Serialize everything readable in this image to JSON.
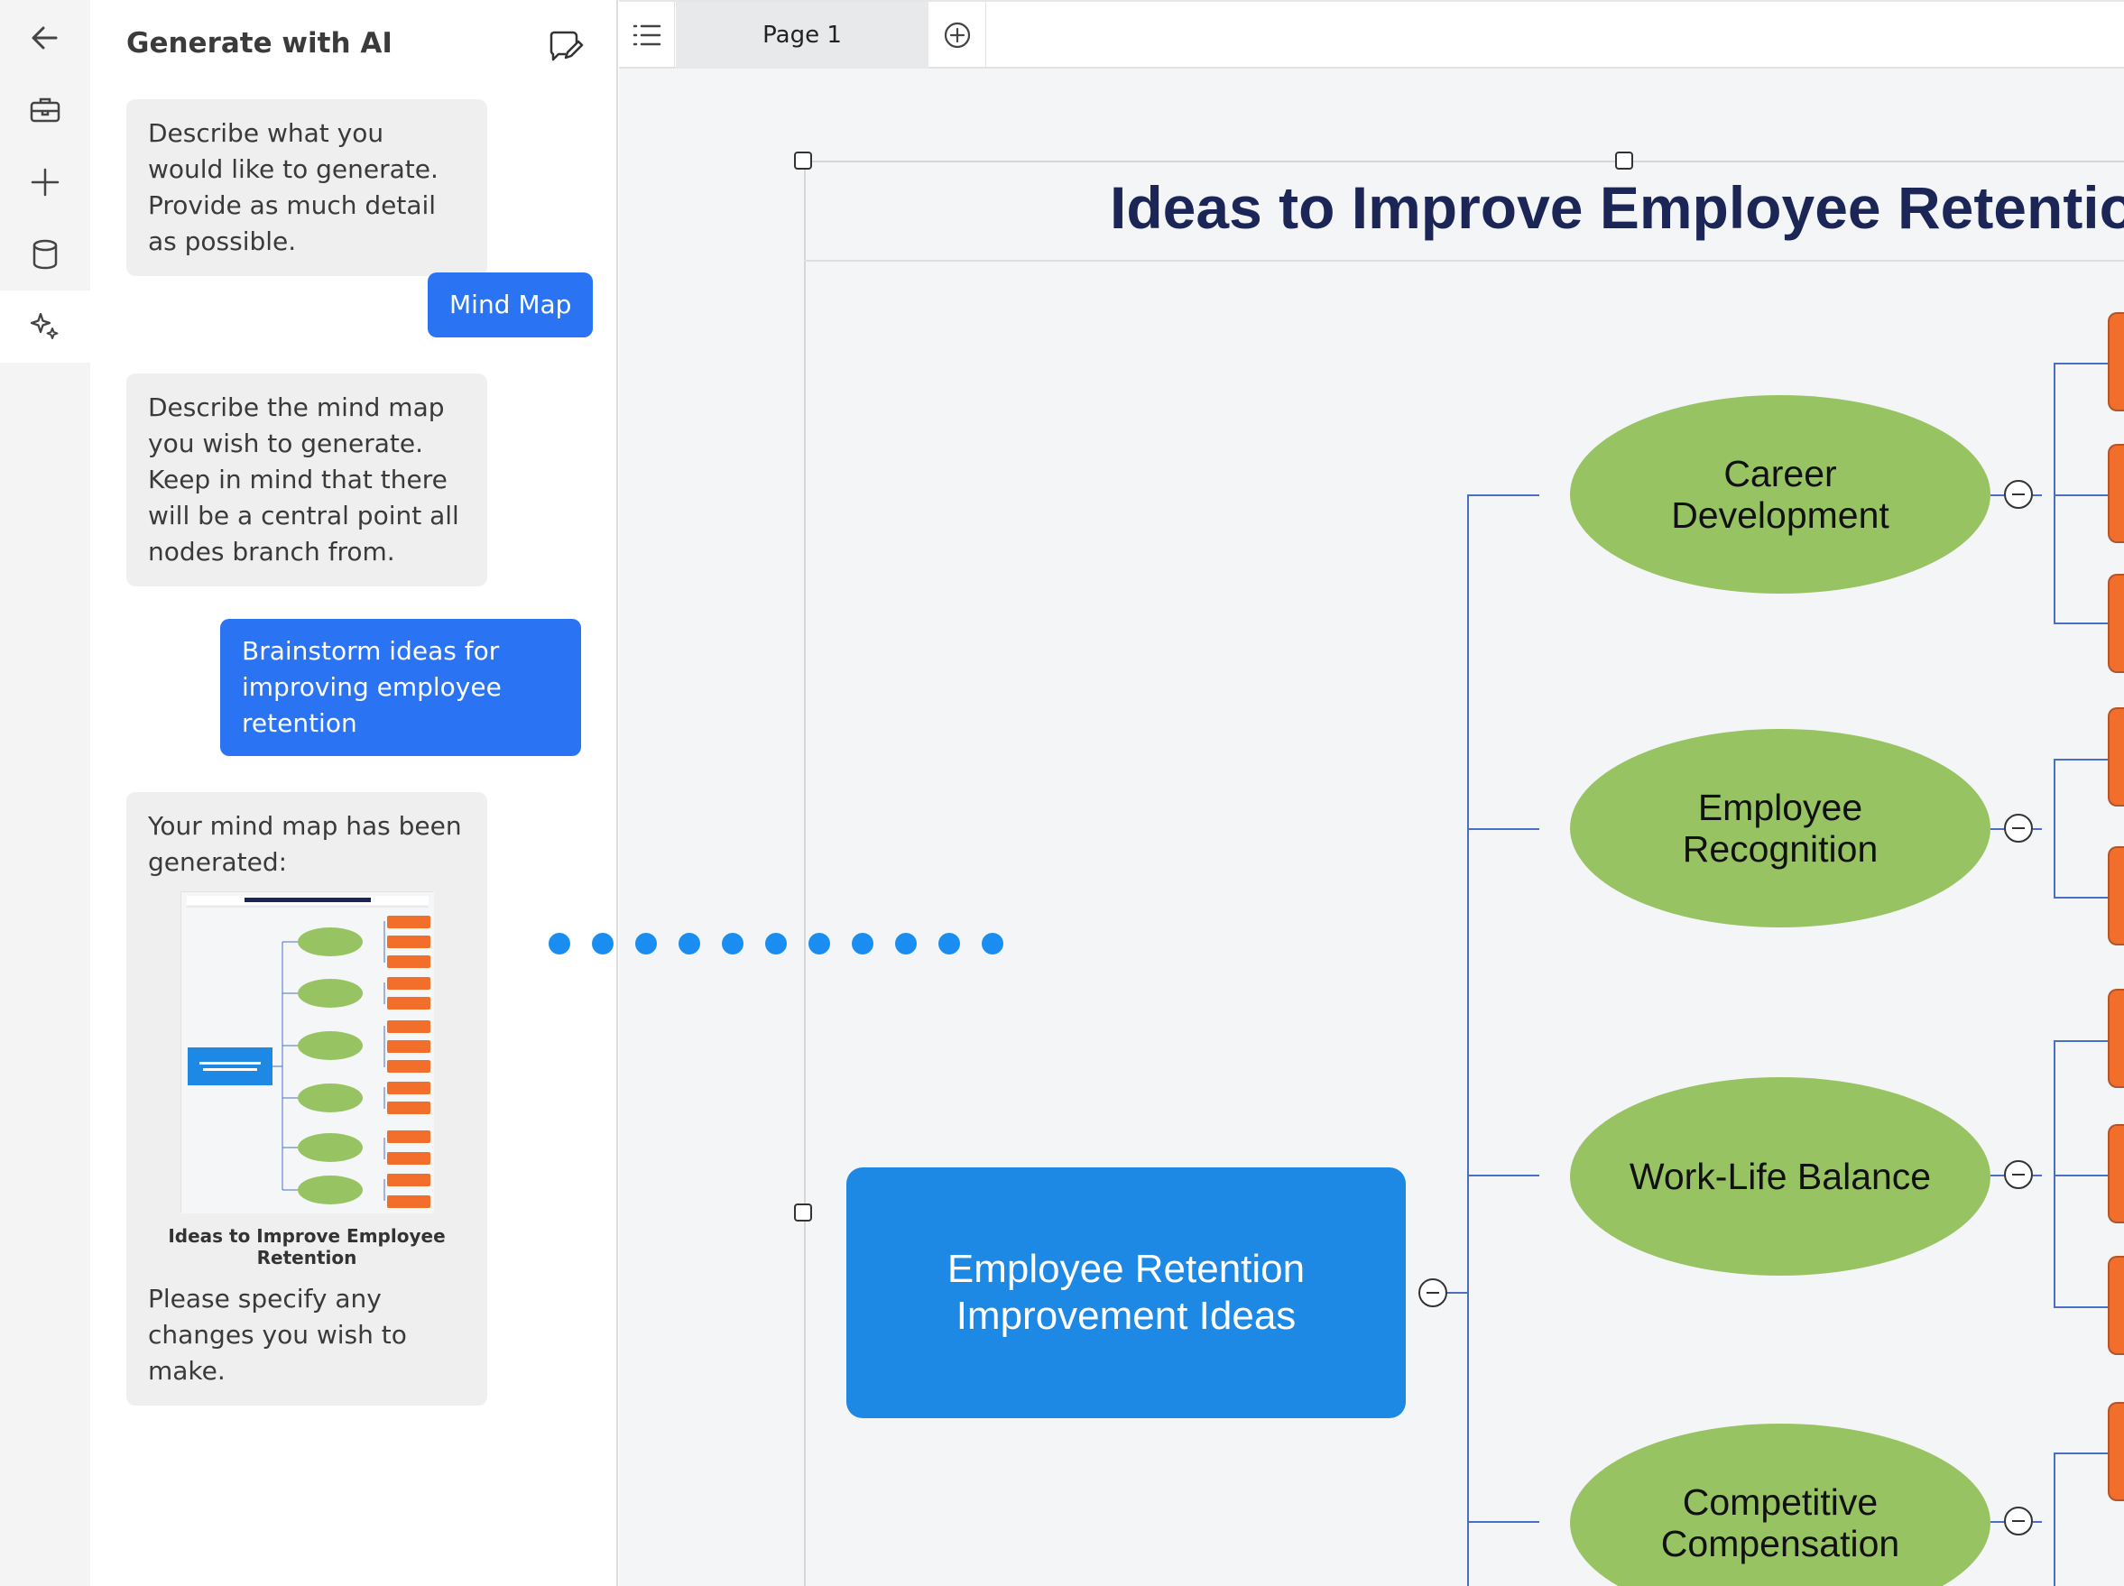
{
  "rail": {
    "items": [
      {
        "icon": "back-arrow-icon"
      },
      {
        "icon": "briefcase-icon"
      },
      {
        "icon": "plus-icon"
      },
      {
        "icon": "database-icon"
      },
      {
        "icon": "ai-sparkle-icon"
      }
    ]
  },
  "panel": {
    "title": "Generate with AI",
    "messages": [
      {
        "role": "ai",
        "text": "Describe what you would like to generate. Provide as much detail as possible."
      },
      {
        "role": "user",
        "text": "Mind Map"
      },
      {
        "role": "ai",
        "text": "Describe the mind map you wish to generate. Keep in mind that there will be a central point all nodes branch from."
      },
      {
        "role": "user",
        "text": "Brainstorm ideas for improving employee retention"
      },
      {
        "role": "ai",
        "text": "Your mind map has been generated:",
        "thumbnail_caption": "Ideas to Improve Employee Retention",
        "after_text": "Please specify any changes you wish to make."
      }
    ]
  },
  "tabs": {
    "pages": [
      "Page 1"
    ]
  },
  "mindmap": {
    "title": "Ideas to Improve Employee Retention",
    "central": "Employee Retention Improvement Ideas",
    "topics": [
      "Career Development",
      "Employee Recognition",
      "Work-Life Balance",
      "Competitive Compensation"
    ],
    "colors": {
      "central": "#1e88e5",
      "topic": "#98c363",
      "leaf": "#f26e2b",
      "connector": "#4a6fc4"
    }
  }
}
